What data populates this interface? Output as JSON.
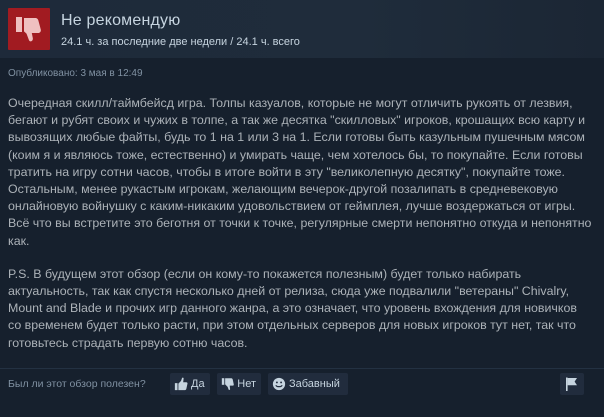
{
  "header": {
    "title": "Не рекомендую",
    "hours": "24.1 ч. за последние две недели / 24.1 ч. всего"
  },
  "posted": "Опубликовано: 3 мая в 12:49",
  "body": {
    "paragraph1": "Очередная скилл/таймбейсд игра. Толпы казуалов, которые не могут отличить рукоять от лезвия, бегают и рубят своих и чужих в толпе, а так же десятка \"скилловых\" игроков, крошащих всю карту и вывозящих любые файты, будь то 1 на 1 или 3 на 1. Если готовы быть казульным пушечным мясом (коим я и являюсь тоже, естественно) и умирать чаще, чем хотелось бы, то покупайте. Если готовы тратить на игру сотни часов, чтобы в итоге войти в эту \"великолепную десятку\", покупайте тоже. Остальным, менее рукастым игрокам, желающим вечерок-другой позалипать в средневековую онлайновую войнушку с каким-никаким удовольствием от геймплея, лучше воздержаться от игры. Всё что вы встретите это беготня от точки к точке, регулярные смерти непонятно откуда и непонятно как.",
    "paragraph2": "P.S. В будущем этот обзор (если он кому-то покажется полезным) будет только набирать актуальность, так как спустя несколько дней от релиза, сюда уже подвалили \"ветераны\" Chivalry, Mount and Blade и прочих игр данного жанра, а это означает, что уровень вхождения для новичков со временем будет только расти, при этом отдельных серверов для новых игроков тут нет, так что готовьтесь страдать первую сотню часов."
  },
  "footer": {
    "question": "Был ли этот обзор полезен?",
    "yes_label": "Да",
    "no_label": "Нет",
    "funny_label": "Забавный"
  },
  "icons": {
    "thumb": "thumbs-down-icon",
    "yes": "thumbs-up-icon",
    "no": "thumbs-down-icon",
    "funny": "smiley-icon",
    "flag": "flag-icon"
  },
  "colors": {
    "not_recommended": "#a11b21",
    "background": "#16202d",
    "header_bg": "#1e2a3a",
    "button_bg": "#212c3d",
    "text": "#acb2b8"
  }
}
